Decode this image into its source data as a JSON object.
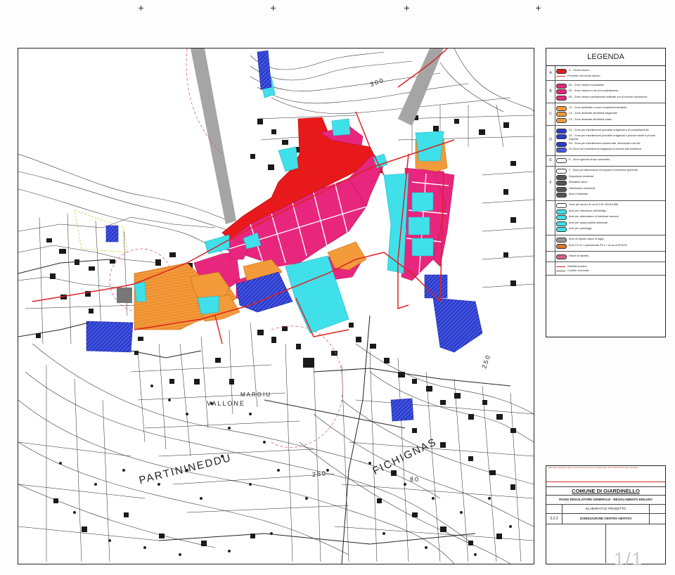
{
  "map": {
    "labels": {
      "vallone": "VALLONE",
      "margiu": "MARGIU",
      "partinineddu": "PARTININEDDU",
      "fichignas": "FICHIGNAS",
      "elev_300": "300",
      "elev_250_a": "250",
      "elev_250_b": "250",
      "elev_80": "80"
    }
  },
  "legend": {
    "title": "LEGENDA",
    "sections": [
      {
        "letter": "A",
        "items": [
          {
            "color": "#e8191a",
            "text": "A - Centro storico"
          },
          {
            "color": "#cc3333",
            "line": true,
            "text": "Perimetro del centro storico"
          }
        ]
      },
      {
        "letter": "B",
        "items": [
          {
            "color": "#e8267d",
            "text": "B1 - Zone urbane consolidate"
          },
          {
            "color": "#e8267d",
            "text": "B2 - Zone urbane in via di completamento"
          },
          {
            "color": "#e8267d",
            "text": "B3 - Zone urbane parzialmente edificate e/o di recente formazione"
          }
        ]
      },
      {
        "letter": "C",
        "items": [
          {
            "color": "#f39a3a",
            "text": "C1 - Zone destinate a nuovi complessi insediativi"
          },
          {
            "color": "#f39a3a",
            "text": "C2 - Zone destinate all'edilizia stagionale"
          },
          {
            "color": "#f39a3a",
            "text": "C3 - Zone destinate all'edilizia mista"
          }
        ]
      },
      {
        "letter": "D",
        "items": [
          {
            "color": "#2a3ccf",
            "text": "D1 - Zone per insediamenti produttivi artigianali e di completamento"
          },
          {
            "color": "#2a3ccf",
            "text": "D2 - Zone per insediamenti produttivi artigianali a piccole medie e piccole imprese"
          },
          {
            "color": "#2a3ccf",
            "text": "D3 - Zone per insediamenti commerciali, direzionali e servizi"
          },
          {
            "color": "#4a5be0",
            "text": "D4 Zone per insediamenti artigianali al servizio alla residenza"
          }
        ]
      },
      {
        "letter": "E",
        "items": [
          {
            "color": "#ffffff",
            "text": "E - Zone agricole di tipo consentito"
          }
        ]
      },
      {
        "letter": "F",
        "items": [
          {
            "color": "#ffffff",
            "text": "F - Zone per attrezzature ed impianti di interesse generale"
          },
          {
            "color": "#555555",
            "text": "Depuratore esistente"
          },
          {
            "color": "#555555",
            "text": "Serbatoio idrico"
          },
          {
            "color": "#555555",
            "text": "Distributore carburanti"
          },
          {
            "color": "#555555",
            "text": "Area Cimiteriale"
          }
        ]
      },
      {
        "letter": "",
        "items": [
          {
            "color": "#ffffff",
            "text": "Zone per servizi di cui al D.M. 02/04/1968"
          },
          {
            "color": "#3fe0ea",
            "text": "Aree per l'istruzione dell'obbligo"
          },
          {
            "color": "#3fe0ea",
            "text": "Aree per attrezzature di interesse comune"
          },
          {
            "color": "#3fe0ea",
            "text": "Aree per spazi pubblici attrezzati"
          },
          {
            "color": "#3fe0ea",
            "text": "Aree per parcheggi"
          }
        ]
      },
      {
        "letter": "",
        "items": [
          {
            "color": "#9a9a9a",
            "text": "Aree di rispetto fasce di taglio"
          },
          {
            "color": "#d9762a",
            "text": "Aree P.U.A. e perimetrale P3 e + di cui al PG4/04"
          }
        ]
      },
      {
        "letter": "",
        "items": [
          {
            "color": "#e05a8a",
            "text": "Fasce di rispetto"
          }
        ]
      },
      {
        "letter": "",
        "items": [
          {
            "color": "#cc2222",
            "line": true,
            "text": "Viabilità di piano"
          },
          {
            "color": "#555555",
            "line": true,
            "text": "Confine comunale"
          }
        ]
      }
    ]
  },
  "title_block": {
    "note": "Elaborato adeguato alle prescrizioni del Comune di Giardinello nella deliberazione del Consiglio ...",
    "comune": "COMUNE DI GIARDINELLO",
    "subtitle": "PIANO REGOLATORE GENERALE - REGOLAMENTO EDILIZIO",
    "elaborato_label": "ELABORATI DI PROGETTO",
    "tavola_code": "0.2.2",
    "tavola_title": "ZONIZZAZIONE CENTRO ABITATO"
  },
  "viewer": {
    "page_counter": "1/1"
  }
}
